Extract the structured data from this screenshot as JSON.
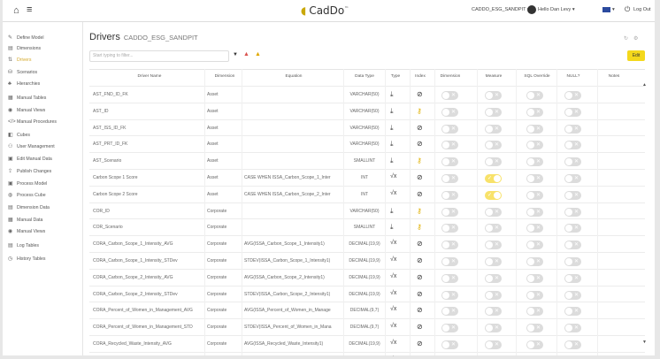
{
  "app": {
    "logo_text": "CadDo",
    "logo_suffix": "™"
  },
  "topbar": {
    "env_selector": "CADDO_ESG_SANDPIT ▾",
    "greeting": "Hello Dan Levy ▾",
    "lang": "▾",
    "logout": "Log Out"
  },
  "sidebar": {
    "items": [
      {
        "label": "Define Model",
        "icon": "✎",
        "active": false
      },
      {
        "label": "Dimensions",
        "icon": "▤",
        "active": false
      },
      {
        "label": "Drivers",
        "icon": "⇅",
        "active": true
      },
      {
        "label": "Scenarios",
        "icon": "⛁",
        "active": false
      },
      {
        "label": "Hierarchies",
        "icon": "♣",
        "active": false
      },
      {
        "label": "Manual Tables",
        "icon": "▦",
        "active": false
      },
      {
        "label": "Manual Views",
        "icon": "◉",
        "active": false
      },
      {
        "label": "Manual Procedures",
        "icon": "</>",
        "active": false
      },
      {
        "label": "Cubes",
        "icon": "◧",
        "active": false
      },
      {
        "label": "User Management",
        "icon": "⚇",
        "active": false
      },
      {
        "label": "Edit Manual Data",
        "icon": "▣",
        "active": false
      },
      {
        "label": "Publish Changes",
        "icon": "⇪",
        "active": false
      },
      {
        "label": "Process Model",
        "icon": "▣",
        "active": false
      },
      {
        "label": "Process Cube",
        "icon": "◍",
        "active": false
      },
      {
        "label": "Dimension Data",
        "icon": "▤",
        "active": false
      },
      {
        "label": "Manual Data",
        "icon": "▦",
        "active": false
      },
      {
        "label": "Manual Views",
        "icon": "◉",
        "active": false
      },
      {
        "label": "Log Tables",
        "icon": "▤",
        "active": false
      },
      {
        "label": "History Tables",
        "icon": "◷",
        "active": false
      }
    ]
  },
  "page": {
    "title": "Drivers",
    "subtitle": "CADDO_ESG_SANDPIT",
    "filter_placeholder": "Start typing to filter...",
    "edit_label": "Edit"
  },
  "columns": [
    "Driver Name",
    "Dimension",
    "Equation",
    "Data Type",
    "Type",
    "Index",
    "Dimension",
    "Measure",
    "SQL Override",
    "NULL?",
    "Notes"
  ],
  "rows": [
    {
      "name": "AST_FND_ID_FK",
      "dimension": "Asset",
      "equation": "",
      "data_type": "VARCHAR(50)",
      "type": "download",
      "index": "null",
      "measure": false
    },
    {
      "name": "AST_ID",
      "dimension": "Asset",
      "equation": "",
      "data_type": "VARCHAR(50)",
      "type": "download",
      "index": "key",
      "measure": false
    },
    {
      "name": "AST_ISS_ID_FK",
      "dimension": "Asset",
      "equation": "",
      "data_type": "VARCHAR(50)",
      "type": "download",
      "index": "null",
      "measure": false
    },
    {
      "name": "AST_PRT_ID_FK",
      "dimension": "Asset",
      "equation": "",
      "data_type": "VARCHAR(50)",
      "type": "download",
      "index": "null",
      "measure": false
    },
    {
      "name": "AST_Scenario",
      "dimension": "Asset",
      "equation": "",
      "data_type": "SMALLINT",
      "type": "download",
      "index": "key",
      "measure": false
    },
    {
      "name": "Carbon Scope 1 Score",
      "dimension": "Asset",
      "equation": "CASE WHEN ISSA_Carbon_Scope_1_Inter",
      "data_type": "INT",
      "type": "formula",
      "index": "null",
      "measure": true
    },
    {
      "name": "Carbon Scope 2 Score",
      "dimension": "Asset",
      "equation": "CASE WHEN ISSA_Carbon_Scope_2_Inter",
      "data_type": "INT",
      "type": "formula",
      "index": "null",
      "measure": true
    },
    {
      "name": "COR_ID",
      "dimension": "Corporate",
      "equation": "",
      "data_type": "VARCHAR(50)",
      "type": "download",
      "index": "key",
      "measure": false
    },
    {
      "name": "COR_Scenario",
      "dimension": "Corporate",
      "equation": "",
      "data_type": "SMALLINT",
      "type": "download",
      "index": "key",
      "measure": false
    },
    {
      "name": "CORA_Carbon_Scope_1_Intensity_AVG",
      "dimension": "Corporate",
      "equation": "AVG(ISSA_Carbon_Scope_1_Intensity1)",
      "data_type": "DECIMAL(19,9)",
      "type": "formula",
      "index": "null",
      "measure": false
    },
    {
      "name": "CORA_Carbon_Scope_1_Intensity_STDev",
      "dimension": "Corporate",
      "equation": "STDEV(ISSA_Carbon_Scope_1_Intensity1)",
      "data_type": "DECIMAL(19,9)",
      "type": "formula",
      "index": "null",
      "measure": false
    },
    {
      "name": "CORA_Carbon_Scope_2_Intensity_AVG",
      "dimension": "Corporate",
      "equation": "AVG(ISSA_Carbon_Scope_2_Intensity1)",
      "data_type": "DECIMAL(19,9)",
      "type": "formula",
      "index": "null",
      "measure": false
    },
    {
      "name": "CORA_Carbon_Scope_2_Intensity_STDev",
      "dimension": "Corporate",
      "equation": "STDEV(ISSA_Carbon_Scope_2_Intensity1)",
      "data_type": "DECIMAL(19,9)",
      "type": "formula",
      "index": "null",
      "measure": false
    },
    {
      "name": "CORA_Percent_of_Women_in_Management_AVG",
      "dimension": "Corporate",
      "equation": "AVG(ISSA_Percent_of_Women_in_Manage",
      "data_type": "DECIMAL(9,7)",
      "type": "formula",
      "index": "null",
      "measure": false
    },
    {
      "name": "CORA_Percent_of_Women_in_Management_STD",
      "dimension": "Corporate",
      "equation": "STDEV(ISSA_Percent_of_Women_in_Mana",
      "data_type": "DECIMAL(9,7)",
      "type": "formula",
      "index": "null",
      "measure": false
    },
    {
      "name": "CORA_Recycled_Waste_Intensity_AVG",
      "dimension": "Corporate",
      "equation": "AVG(ISSA_Recycled_Waste_Intensity1)",
      "data_type": "DECIMAL(19,9)",
      "type": "formula",
      "index": "null",
      "measure": false
    },
    {
      "name": "",
      "dimension": "",
      "equation": "",
      "data_type": "",
      "type": "formula",
      "index": "null",
      "measure": false
    }
  ],
  "icons": {
    "home": "home-icon",
    "menu": "hamburger-icon",
    "user": "user-avatar-icon",
    "flag": "flag-icon",
    "logout": "power-icon",
    "warning_red": "warning-red-icon",
    "warning_yellow": "warning-yellow-icon"
  },
  "colors": {
    "accent": "#f4d81c",
    "active_nav": "#d4a82a",
    "toggle_off": "#dcdcdc",
    "toggle_on": "#f8e26a",
    "warn_red": "#d9534f"
  }
}
